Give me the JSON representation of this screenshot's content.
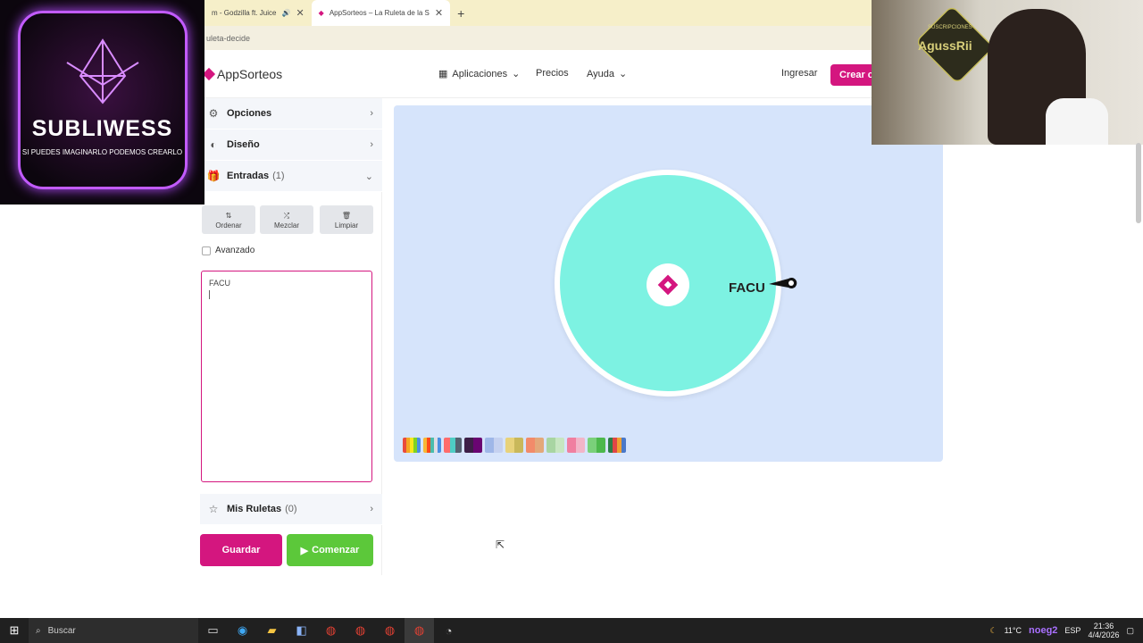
{
  "browser": {
    "tabs": [
      {
        "title": "m - Godzilla ft. Juice",
        "icons": [
          "speaker-icon",
          "close-icon"
        ]
      },
      {
        "title": "AppSorteos – La Ruleta de la S",
        "icons": [
          "close-icon"
        ]
      }
    ],
    "new_tab": "+",
    "url": "uleta-decide"
  },
  "header": {
    "brand": "AppSorteos",
    "nav": [
      "Aplicaciones",
      "Precios",
      "Ayuda"
    ],
    "login": "Ingresar",
    "cta": "Crear c"
  },
  "panel": {
    "sections": {
      "opciones": "Opciones",
      "diseno": "Diseño",
      "entradas": "Entradas",
      "entradas_count": "(1)",
      "ruletas": "Mis Ruletas",
      "ruletas_count": "(0)"
    },
    "tools": [
      "Ordenar",
      "Mezclar",
      "Limpiar"
    ],
    "advanced": "Avanzado",
    "entries_text": "FACU",
    "save": "Guardar",
    "start": "Comenzar"
  },
  "wheel": {
    "label": "FACU",
    "segment_color": "#7df2e2",
    "accent": "#d4167f"
  },
  "palettes": [
    [
      "#e94b3c",
      "#f5a623",
      "#f8e71c",
      "#7ed321",
      "#4a90e2"
    ],
    [
      "#f7b733",
      "#fc4a1a",
      "#4abdac",
      "#dfdce3",
      "#4a90e2"
    ],
    [
      "#ff6b6b",
      "#4ecdc4",
      "#556270"
    ],
    [
      "#3e1f47",
      "#6a0572"
    ],
    [
      "#9fb7e8",
      "#c5d1f0"
    ],
    [
      "#e8d27a",
      "#c9b85a"
    ],
    [
      "#f28b6a",
      "#e3a87a"
    ],
    [
      "#a8d5a2",
      "#c7e6c1"
    ],
    [
      "#f07fa0",
      "#f2b5c8"
    ],
    [
      "#7ad07a",
      "#4cb84c"
    ],
    [
      "#2d7d46",
      "#e04646",
      "#f0a030",
      "#4a78c8"
    ]
  ],
  "overlay_left": {
    "brand": "SUBLIWESS",
    "tagline": "SI PUEDES IMAGINARLO PODEMOS CREARLO"
  },
  "overlay_right": {
    "name": "AgussRii",
    "small": "SUSCRIPCIONES"
  },
  "taskbar": {
    "search": "Buscar",
    "weather": "11°C",
    "lang": "ESP",
    "time": "21:36",
    "date": "4/4/2026",
    "user": "noeg2"
  }
}
